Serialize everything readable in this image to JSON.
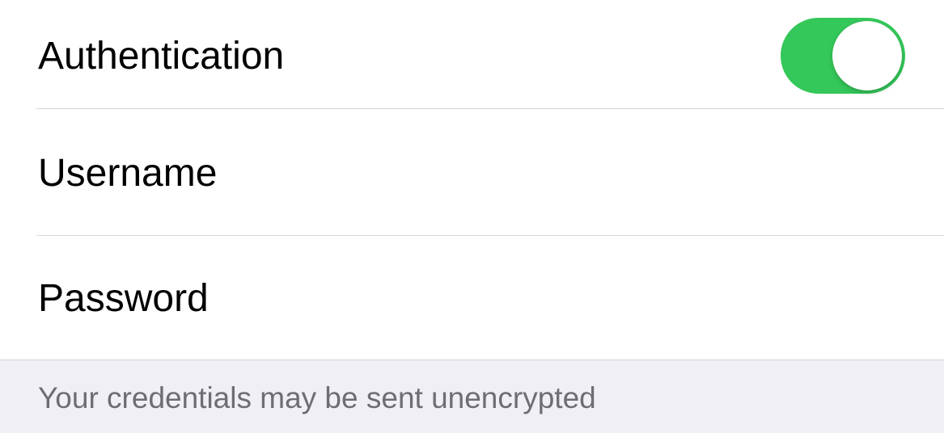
{
  "settings": {
    "authentication": {
      "label": "Authentication",
      "enabled": true,
      "toggle_color": "#34c759"
    },
    "username": {
      "label": "Username"
    },
    "password": {
      "label": "Password"
    },
    "footer_note": "Your credentials may be sent unencrypted"
  }
}
